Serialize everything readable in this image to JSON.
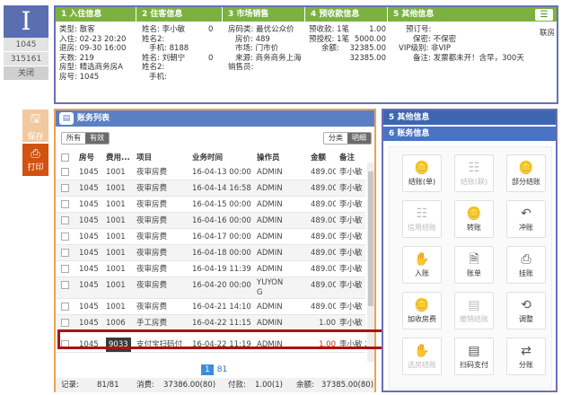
{
  "left": {
    "logo": "I",
    "items": [
      "1045",
      "315161",
      "关闭"
    ]
  },
  "header": {
    "sections": [
      "1 入住信息",
      "2 住客信息",
      "3 市场销售",
      "4 预收款信息",
      "5 其他信息"
    ],
    "list_icon": "list-icon"
  },
  "checkin": [
    "类型: 散客",
    "入住: 02-23 20:20",
    "退房: 09-30 16:00",
    "天数: 219",
    "房型: 精选商务房A",
    "房号: 1045"
  ],
  "guest": {
    "name1_label": "姓名: 李小敏",
    "name1_count": "0",
    "name2_label": "姓名2:",
    "phone1": "手机: 8188",
    "name3_label": "姓名: 刘朝宁",
    "name3_count": "0",
    "name4_label": "姓名2:",
    "phone2": "手机:"
  },
  "market": [
    "房码类: 最优公众价",
    "房价: 489",
    "市场: 门市价",
    "来源: 商务商务上海",
    "销售员:"
  ],
  "deposit": {
    "l1": "预收款: 1笔",
    "v1": "1.00",
    "l2": "预授权: 1笔",
    "v2": "5000.00",
    "l3": "余额:",
    "v3": "32385.00",
    "v4": "32385.00"
  },
  "other": {
    "lines": [
      "预订号:",
      "保密: 不保密",
      "VIP级别: 非VIP",
      "备注: 发票都未开！含早，300天"
    ],
    "link": "联房"
  },
  "actions": {
    "save": "保存",
    "print": "打印"
  },
  "list": {
    "title": "账务列表",
    "filter_tabs": [
      "所有",
      "有效"
    ],
    "view_tabs": [
      "分类",
      "明细"
    ],
    "columns": [
      "房号",
      "费用...",
      "项目",
      "业务时间",
      "操作员",
      "金额",
      "备注"
    ],
    "rows": [
      {
        "room": "1045",
        "code": "1001",
        "item": "夜审房费",
        "time": "16-04-13 00:00",
        "op": "ADMIN",
        "amount": "489.00",
        "note": "李小敏"
      },
      {
        "room": "1045",
        "code": "1001",
        "item": "夜审房费",
        "time": "16-04-14 16:58",
        "op": "ADMIN",
        "amount": "489.00",
        "note": "李小敏"
      },
      {
        "room": "1045",
        "code": "1001",
        "item": "夜审房费",
        "time": "16-04-15 00:00",
        "op": "ADMIN",
        "amount": "489.00",
        "note": "李小敏"
      },
      {
        "room": "1045",
        "code": "1001",
        "item": "夜审房费",
        "time": "16-04-16 00:00",
        "op": "ADMIN",
        "amount": "489.00",
        "note": "李小敏"
      },
      {
        "room": "1045",
        "code": "1001",
        "item": "夜审房费",
        "time": "16-04-17 00:00",
        "op": "ADMIN",
        "amount": "489.00",
        "note": "李小敏"
      },
      {
        "room": "1045",
        "code": "1001",
        "item": "夜审房费",
        "time": "16-04-18 00:00",
        "op": "ADMIN",
        "amount": "489.00",
        "note": "李小敏"
      },
      {
        "room": "1045",
        "code": "1001",
        "item": "夜审房费",
        "time": "16-04-19 11:39",
        "op": "ADMIN",
        "amount": "489.00",
        "note": "李小敏"
      },
      {
        "room": "1045",
        "code": "1001",
        "item": "夜审房费",
        "time": "16-04-20 00:00",
        "op": "YUYON",
        "op2": "G",
        "amount": "489.00",
        "note": "李小敏"
      },
      {
        "room": "1045",
        "code": "1001",
        "item": "夜审房费",
        "time": "16-04-21 14:10",
        "op": "ADMIN",
        "amount": "489.00",
        "note": "李小敏"
      },
      {
        "room": "1045",
        "code": "1006",
        "item": "手工房费",
        "time": "16-04-22 11:15",
        "op": "ADMIN",
        "amount": "1.00",
        "note": "李小敏"
      },
      {
        "room": "1045",
        "code": "9033",
        "item": "支付宝扫码付",
        "time": "16-04-22 11:19",
        "op": "ADMIN",
        "amount": "1.00",
        "note": "李小敏 26"
      }
    ],
    "pager": {
      "current": "1",
      "total": "81"
    },
    "footer": {
      "records_label": "记录:",
      "records": "81/81",
      "consume_label": "消费:",
      "consume": "37386.00(80)",
      "pay_label": "付款:",
      "pay": "1.00(1)",
      "balance_label": "余额:",
      "balance": "37385.00(80)"
    }
  },
  "right": {
    "sections": [
      "5 其他信息",
      "6 账务信息"
    ],
    "buttons": [
      {
        "label": "结账(单)",
        "icon": "coins-icon",
        "glyph": "🪙",
        "disabled": false
      },
      {
        "label": "结账(联)",
        "icon": "flow-icon",
        "glyph": "☷",
        "disabled": true
      },
      {
        "label": "部分结账",
        "icon": "coins-icon",
        "glyph": "🪙",
        "disabled": false
      },
      {
        "label": "信用结账",
        "icon": "flow-icon",
        "glyph": "☷",
        "disabled": true
      },
      {
        "label": "转账",
        "icon": "coins-icon",
        "glyph": "🪙",
        "disabled": false
      },
      {
        "label": "冲账",
        "icon": "return-icon",
        "glyph": "↶",
        "disabled": false
      },
      {
        "label": "入账",
        "icon": "hand-coin-icon",
        "glyph": "✋",
        "disabled": false
      },
      {
        "label": "账单",
        "icon": "bill-icon",
        "glyph": "🗎",
        "disabled": false
      },
      {
        "label": "挂账",
        "icon": "print-icon",
        "glyph": "⎙",
        "disabled": false
      },
      {
        "label": "加收房费",
        "icon": "coins-icon",
        "glyph": "🪙",
        "disabled": false
      },
      {
        "label": "撤销结账",
        "icon": "cards-icon",
        "glyph": "▤",
        "disabled": true
      },
      {
        "label": "调整",
        "icon": "cycle-icon",
        "glyph": "⟲",
        "disabled": false
      },
      {
        "label": "选房结账",
        "icon": "hand-coin-icon",
        "glyph": "✋",
        "disabled": true
      },
      {
        "label": "扫码支付",
        "icon": "cards-icon",
        "glyph": "▤",
        "disabled": false
      },
      {
        "label": "分账",
        "icon": "split-icon",
        "glyph": "⇄",
        "disabled": false
      }
    ]
  }
}
